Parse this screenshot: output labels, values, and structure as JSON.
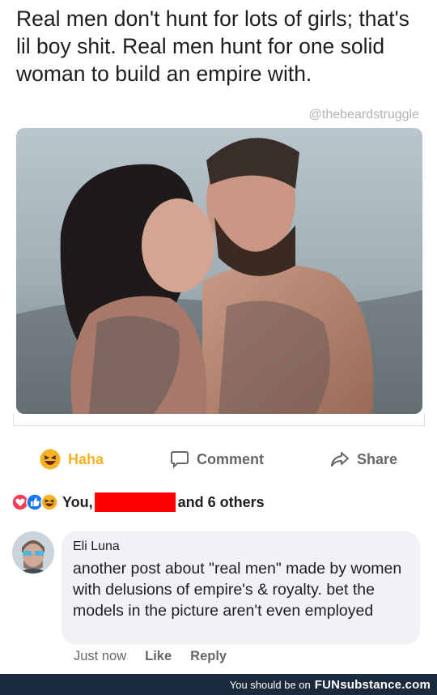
{
  "post": {
    "text": "Real men don't hunt for lots of girls; that's lil boy shit. Real men hunt for one solid woman to build an empire with.",
    "watermark": "@thebeardstruggle"
  },
  "actions": {
    "haha": "Haha",
    "comment": "Comment",
    "share": "Share"
  },
  "reactions": {
    "icons": [
      "love-react",
      "like-react",
      "haha-react"
    ],
    "prefix": "You,",
    "suffix": "and 6 others"
  },
  "comment": {
    "author": "Eli Luna",
    "text": "another post about \"real men\" made by women with delusions of empire's & royalty. bet the models in the picture aren't even employed",
    "time": "Just now",
    "like": "Like",
    "reply": "Reply"
  },
  "footer": {
    "prefix": "You should be on",
    "brand": "FUNsubstance.com"
  },
  "colors": {
    "haha_accent": "#f7b125",
    "redaction": "#ff0000",
    "footer_bg": "#1c2a3d"
  }
}
